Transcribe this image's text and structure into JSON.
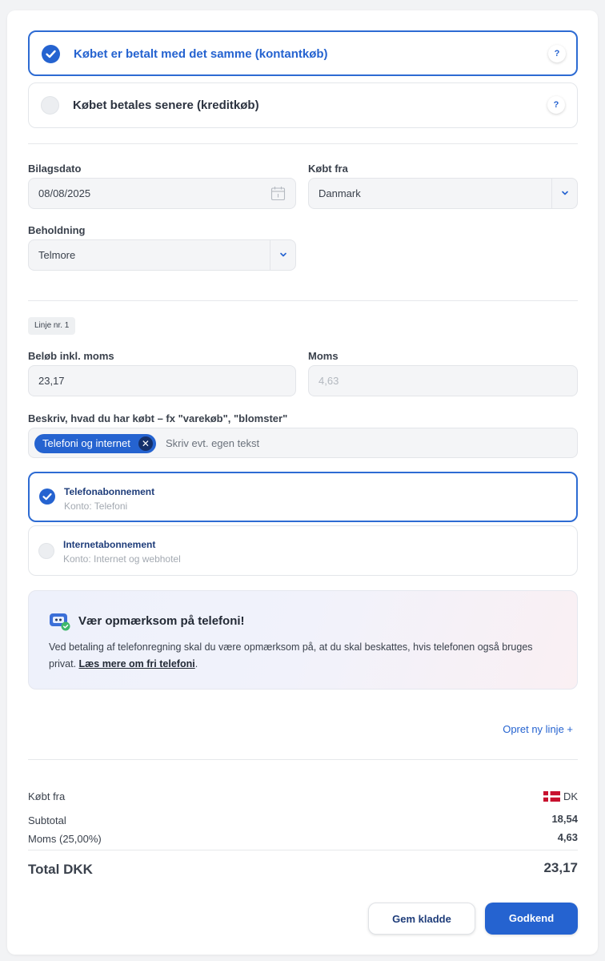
{
  "payment": {
    "cash_label": "Købet er betalt med det samme (kontantkøb)",
    "credit_label": "Købet betales senere (kreditkøb)",
    "help_glyph": "?"
  },
  "form": {
    "date_label": "Bilagsdato",
    "date_value": "08/08/2025",
    "bought_from_label": "Købt fra",
    "bought_from_value": "Danmark",
    "holding_label": "Beholdning",
    "holding_value": "Telmore"
  },
  "line": {
    "badge": "Linje nr. 1",
    "amount_label": "Beløb inkl. moms",
    "amount_value": "23,17",
    "vat_label": "Moms",
    "vat_value": "4,63",
    "description_label": "Beskriv, hvad du har købt – fx \"varekøb\", \"blomster\"",
    "chip_label": "Telefoni og internet",
    "description_placeholder": "Skriv evt. egen tekst",
    "options": [
      {
        "title": "Telefonabonnement",
        "meta": "Konto: Telefoni"
      },
      {
        "title": "Internetabonnement",
        "meta": "Konto: Internet og webhotel"
      }
    ]
  },
  "notice": {
    "title": "Vær opmærksom på telefoni!",
    "text": "Ved betaling af telefonregning skal du være opmærksom på, at du skal beskattes, hvis telefonen også bruges privat. ",
    "link": "Læs mere om fri telefoni",
    "text_end": "."
  },
  "new_line_link": "Opret ny linje +",
  "summary": {
    "bought_from_label": "Købt fra",
    "country_code": "DK",
    "subtotal_label": "Subtotal",
    "subtotal_value": "18,54",
    "vat_label": "Moms (25,00%)",
    "vat_value": "4,63",
    "total_label": "Total DKK",
    "total_value": "23,17"
  },
  "buttons": {
    "save_draft": "Gem kladde",
    "approve": "Godkend"
  },
  "colors": {
    "accent": "#2563d0",
    "flag_red": "#c8102e"
  }
}
